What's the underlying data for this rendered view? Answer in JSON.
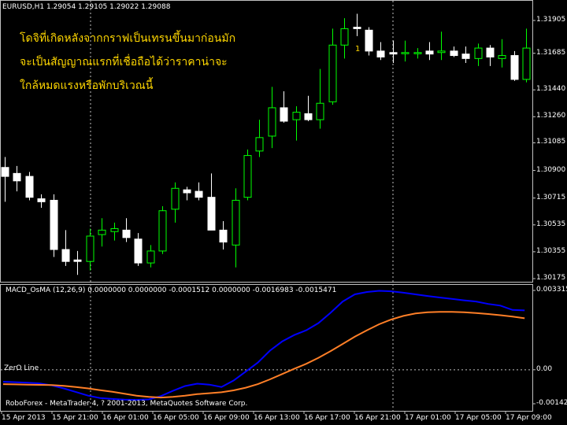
{
  "colors": {
    "background": "#000000",
    "bull_candle": "#00ff00",
    "bear_candle": "#ffffff",
    "macd_line": "#0000ff",
    "signal_line": "#ff7f27",
    "annotation": "#ffd700",
    "grid": "#c0c0c0",
    "axis_text": "#ffffff"
  },
  "header": {
    "symbol_line": "EURUSD,H1  1.29054 1.29105 1.29022 1.29088",
    "indicator_line": "MACD_OsMA (12,26,9) 0.0000000 0.0000000 -0.0001512 0.0000000 -0.0016983 -0.0015471",
    "footer": "RoboForex - MetaTrader 4, ? 2001-2013, MetaQuotes Software Corp.",
    "zero_line_label": "ZerO Line",
    "wave_label": "1"
  },
  "annotation": {
    "line1": "โดจิที่เกิดหลังจากกราฟเป็นเทรนขึ้นมาก่อนมัก",
    "line2": "จะเป็นสัญญาณแรกที่เชื่อถือได้ว่าราคาน่าจะ",
    "line3": "ใกล้หมดแรงหรือพักบริเวณนี้"
  },
  "chart_data": [
    {
      "type": "candlestick",
      "title": "EURUSD,H1",
      "y_ticks": [
        "1.31905",
        "1.31685",
        "1.31440",
        "1.31260",
        "1.31085",
        "1.30900",
        "1.30715",
        "1.30535",
        "1.30355",
        "1.30175"
      ],
      "ylim": [
        1.30175,
        1.31905
      ],
      "x_ticks": [
        "15 Apr 2013",
        "15 Apr 21:00",
        "16 Apr 01:00",
        "16 Apr 05:00",
        "16 Apr 09:00",
        "16 Apr 13:00",
        "16 Apr 17:00",
        "16 Apr 21:00",
        "17 Apr 01:00",
        "17 Apr 05:00",
        "17 Apr 09:00"
      ],
      "candles": [
        {
          "o": 1.3092,
          "h": 1.3099,
          "l": 1.3069,
          "c": 1.3086
        },
        {
          "o": 1.3088,
          "h": 1.3093,
          "l": 1.3076,
          "c": 1.3083
        },
        {
          "o": 1.3086,
          "h": 1.3089,
          "l": 1.307,
          "c": 1.3072
        },
        {
          "o": 1.3071,
          "h": 1.3074,
          "l": 1.3065,
          "c": 1.3069
        },
        {
          "o": 1.307,
          "h": 1.3074,
          "l": 1.3032,
          "c": 1.3037
        },
        {
          "o": 1.3037,
          "h": 1.305,
          "l": 1.3026,
          "c": 1.3029
        },
        {
          "o": 1.303,
          "h": 1.3036,
          "l": 1.302,
          "c": 1.3029
        },
        {
          "o": 1.3029,
          "h": 1.3051,
          "l": 1.3023,
          "c": 1.3046
        },
        {
          "o": 1.3047,
          "h": 1.3058,
          "l": 1.3039,
          "c": 1.305
        },
        {
          "o": 1.3049,
          "h": 1.3055,
          "l": 1.3043,
          "c": 1.3051
        },
        {
          "o": 1.305,
          "h": 1.3058,
          "l": 1.3042,
          "c": 1.3045
        },
        {
          "o": 1.3044,
          "h": 1.3048,
          "l": 1.3026,
          "c": 1.3028
        },
        {
          "o": 1.3028,
          "h": 1.304,
          "l": 1.3025,
          "c": 1.3036
        },
        {
          "o": 1.3036,
          "h": 1.3066,
          "l": 1.3034,
          "c": 1.3063
        },
        {
          "o": 1.3064,
          "h": 1.3082,
          "l": 1.3055,
          "c": 1.3078
        },
        {
          "o": 1.3077,
          "h": 1.3079,
          "l": 1.307,
          "c": 1.3075
        },
        {
          "o": 1.3076,
          "h": 1.3082,
          "l": 1.307,
          "c": 1.3072
        },
        {
          "o": 1.3072,
          "h": 1.3088,
          "l": 1.305,
          "c": 1.305
        },
        {
          "o": 1.305,
          "h": 1.3056,
          "l": 1.3037,
          "c": 1.3042
        },
        {
          "o": 1.304,
          "h": 1.3078,
          "l": 1.3025,
          "c": 1.307
        },
        {
          "o": 1.3072,
          "h": 1.3104,
          "l": 1.307,
          "c": 1.31
        },
        {
          "o": 1.3103,
          "h": 1.3124,
          "l": 1.3099,
          "c": 1.3112
        },
        {
          "o": 1.3113,
          "h": 1.3146,
          "l": 1.3105,
          "c": 1.3132
        },
        {
          "o": 1.3132,
          "h": 1.3143,
          "l": 1.3122,
          "c": 1.3123
        },
        {
          "o": 1.3124,
          "h": 1.3133,
          "l": 1.311,
          "c": 1.3129
        },
        {
          "o": 1.3128,
          "h": 1.314,
          "l": 1.3123,
          "c": 1.3124
        },
        {
          "o": 1.3124,
          "h": 1.3158,
          "l": 1.3118,
          "c": 1.3135
        },
        {
          "o": 1.3136,
          "h": 1.3185,
          "l": 1.3134,
          "c": 1.3174
        },
        {
          "o": 1.3174,
          "h": 1.3192,
          "l": 1.3165,
          "c": 1.3185
        },
        {
          "o": 1.3186,
          "h": 1.3195,
          "l": 1.318,
          "c": 1.3185
        },
        {
          "o": 1.3184,
          "h": 1.3186,
          "l": 1.3167,
          "c": 1.317
        },
        {
          "o": 1.317,
          "h": 1.3176,
          "l": 1.3164,
          "c": 1.3166
        },
        {
          "o": 1.3169,
          "h": 1.3177,
          "l": 1.3162,
          "c": 1.3168
        },
        {
          "o": 1.3169,
          "h": 1.3177,
          "l": 1.3163,
          "c": 1.3169
        },
        {
          "o": 1.3169,
          "h": 1.3172,
          "l": 1.3165,
          "c": 1.3169
        },
        {
          "o": 1.317,
          "h": 1.3176,
          "l": 1.3164,
          "c": 1.3168
        },
        {
          "o": 1.3169,
          "h": 1.3183,
          "l": 1.3164,
          "c": 1.317
        },
        {
          "o": 1.317,
          "h": 1.3173,
          "l": 1.3166,
          "c": 1.3167
        },
        {
          "o": 1.3168,
          "h": 1.3173,
          "l": 1.3162,
          "c": 1.3165
        },
        {
          "o": 1.3165,
          "h": 1.3175,
          "l": 1.316,
          "c": 1.3172
        },
        {
          "o": 1.3172,
          "h": 1.3174,
          "l": 1.316,
          "c": 1.3166
        },
        {
          "o": 1.3165,
          "h": 1.3178,
          "l": 1.3159,
          "c": 1.3167
        },
        {
          "o": 1.3167,
          "h": 1.317,
          "l": 1.315,
          "c": 1.3151
        },
        {
          "o": 1.3151,
          "h": 1.3185,
          "l": 1.3149,
          "c": 1.3172
        }
      ]
    },
    {
      "type": "line",
      "title": "MACD_OsMA (12,26,9)",
      "y_ticks": [
        "0.003315",
        "0.00",
        "-0.00142"
      ],
      "ylim": [
        -0.00142,
        0.003315
      ],
      "zero_line": 0,
      "series": [
        {
          "name": "MACD",
          "values": [
            -0.0005,
            -0.00052,
            -0.00054,
            -0.00057,
            -0.00065,
            -0.00078,
            -0.00093,
            -0.00108,
            -0.00118,
            -0.00122,
            -0.00125,
            -0.00126,
            -0.00124,
            -0.0011,
            -0.00088,
            -0.00068,
            -0.00058,
            -0.00062,
            -0.00072,
            -0.00045,
            -8e-05,
            0.0003,
            0.0008,
            0.00118,
            0.00145,
            0.00165,
            0.00195,
            0.00238,
            0.00285,
            0.00315,
            0.00325,
            0.0033,
            0.00328,
            0.00322,
            0.00315,
            0.00308,
            0.00302,
            0.00296,
            0.0029,
            0.00285,
            0.00275,
            0.00268,
            0.0025,
            0.00248
          ]
        },
        {
          "name": "Signal",
          "values": [
            -0.0006,
            -0.00061,
            -0.00062,
            -0.00063,
            -0.00064,
            -0.00067,
            -0.00072,
            -0.00078,
            -0.00085,
            -0.00092,
            -0.001,
            -0.00108,
            -0.00113,
            -0.00116,
            -0.00113,
            -0.00108,
            -0.00102,
            -0.00098,
            -0.00094,
            -0.00086,
            -0.00075,
            -0.0006,
            -0.0004,
            -0.00018,
            4e-05,
            0.00025,
            0.0005,
            0.00078,
            0.00108,
            0.00138,
            0.00165,
            0.0019,
            0.0021,
            0.00225,
            0.00235,
            0.0024,
            0.00242,
            0.00242,
            0.0024,
            0.00237,
            0.00233,
            0.00228,
            0.00222,
            0.00215
          ]
        }
      ]
    }
  ]
}
